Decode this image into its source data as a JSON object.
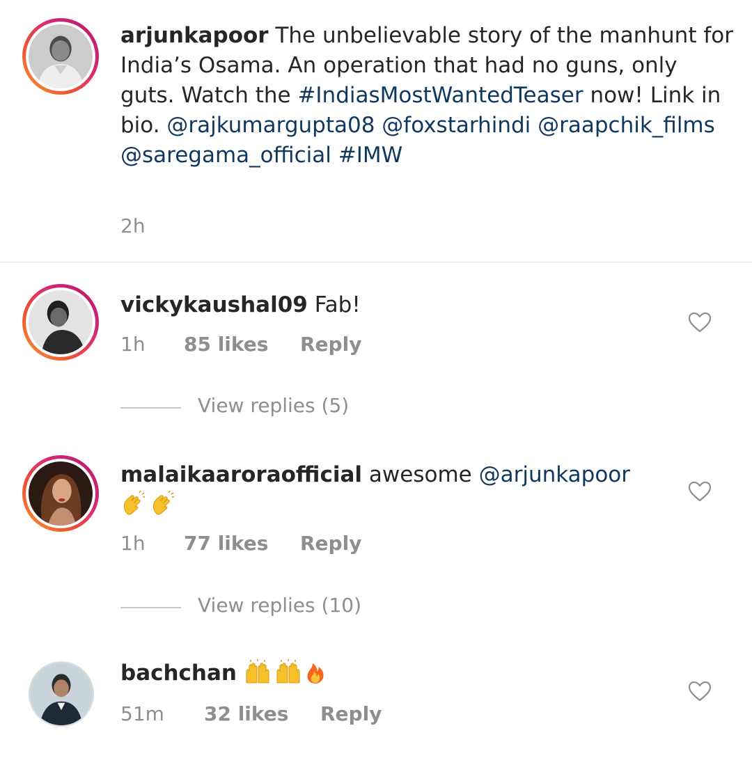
{
  "post": {
    "username": "arjunkapoor",
    "caption_segments": [
      {
        "text": " The unbelievable story of the manhunt for India’s Osama. An operation that had no guns, only guts. Watch the ",
        "type": "text"
      },
      {
        "text": "#IndiasMostWantedTeaser",
        "type": "link"
      },
      {
        "text": " now! Link in bio. ",
        "type": "text"
      },
      {
        "text": "@rajkumargupta08",
        "type": "link"
      },
      {
        "text": " ",
        "type": "text"
      },
      {
        "text": "@foxstarhindi",
        "type": "link"
      },
      {
        "text": " ",
        "type": "text"
      },
      {
        "text": "@raapchik_films",
        "type": "link"
      },
      {
        "text": " ",
        "type": "text"
      },
      {
        "text": "@saregama_official",
        "type": "link"
      },
      {
        "text": " ",
        "type": "text"
      },
      {
        "text": "#IMW",
        "type": "link"
      }
    ],
    "time": "2h"
  },
  "comments": [
    {
      "username": "vickykaushal09",
      "text": " Fab!",
      "time": "1h",
      "likes": "85 likes",
      "reply": "Reply",
      "view_replies": "View replies (5)",
      "avatar_story_ring": true,
      "heart_icon": "heart-outline-icon"
    },
    {
      "username": "malaikaaroraofficial",
      "text": " awesome ",
      "mention": "@arjunkapoor",
      "emojis": [
        "clapping-hands",
        "clapping-hands"
      ],
      "time": "1h",
      "likes": "77 likes",
      "reply": "Reply",
      "view_replies": "View replies (10)",
      "avatar_story_ring": true,
      "heart_icon": "heart-outline-icon"
    },
    {
      "username": "bachchan",
      "emojis": [
        "raising-hands",
        "raising-hands",
        "fire"
      ],
      "time": "51m",
      "likes": "32 likes",
      "reply": "Reply",
      "avatar_story_ring": false,
      "heart_icon": "heart-outline-icon"
    }
  ],
  "colors": {
    "text": "#262626",
    "link": "#10385e",
    "secondary": "#8e8e8e",
    "divider": "#dbdbdb",
    "story_ring_start": "#b4176b",
    "story_ring_end": "#f7a33a"
  }
}
